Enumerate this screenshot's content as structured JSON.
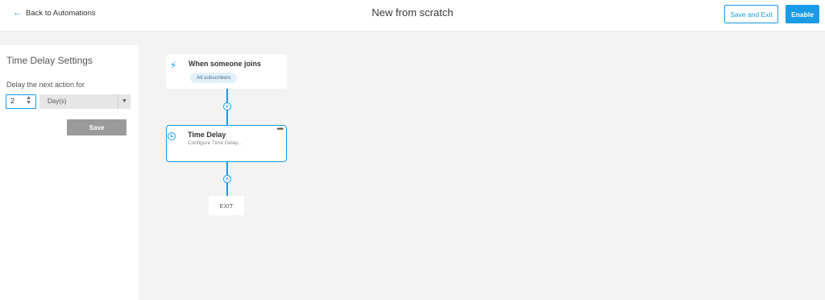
{
  "header": {
    "back_label": "Back to Automations",
    "title": "New from scratch",
    "save_exit_label": "Save and Exit",
    "enable_label": "Enable"
  },
  "sidebar": {
    "title": "Time Delay Settings",
    "delay_label": "Delay the next action for",
    "delay_value": "2",
    "unit_value": "Day(s)",
    "save_label": "Save"
  },
  "flow": {
    "trigger_title": "When someone joins",
    "trigger_pill": "All subscribers",
    "delay_title": "Time Delay",
    "delay_sub": "Configure Time Delay...",
    "exit_label": "EXIT"
  },
  "colors": {
    "accent": "#1a9be8",
    "disabled": "#9a9a9a"
  },
  "icons": [
    "arrow-left-icon",
    "lightning-icon",
    "clock-icon",
    "plus-circle-icon",
    "more-dots-icon"
  ]
}
